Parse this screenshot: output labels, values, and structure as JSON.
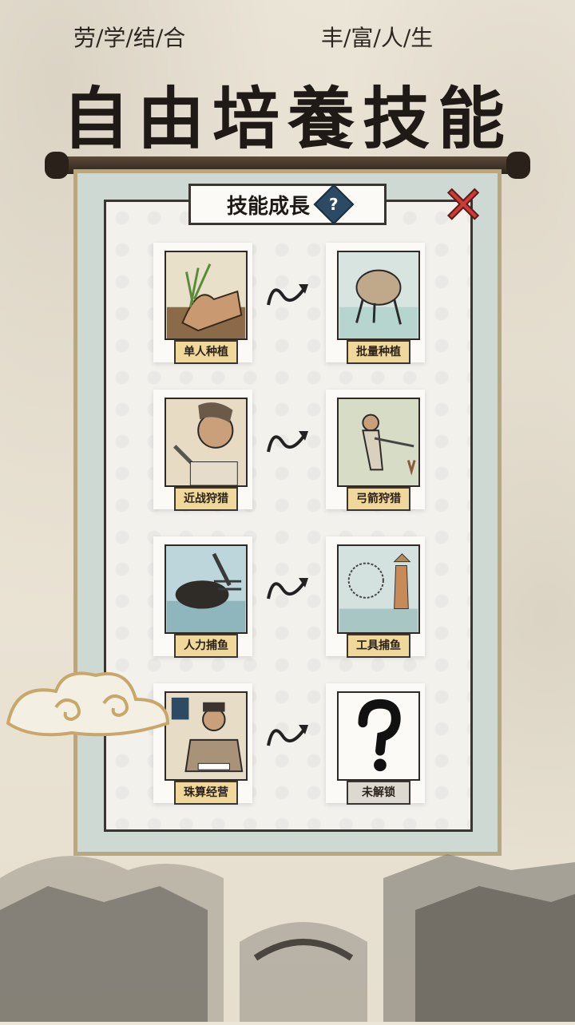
{
  "slogan": {
    "left": "劳/学/结/合",
    "right": "丰/富/人/生"
  },
  "headline": "自由培養技能",
  "panel": {
    "title": "技能成長",
    "help_icon": "question-diamond-icon",
    "close_icon": "close-x-icon"
  },
  "skills": [
    {
      "from": "单人种植",
      "to": "批量种植"
    },
    {
      "from": "近战狩猎",
      "to": "弓箭狩猎"
    },
    {
      "from": "人力捕鱼",
      "to": "工具捕鱼"
    },
    {
      "from": "珠算经营",
      "to": "未解锁"
    }
  ],
  "colors": {
    "tag": "#f0d79a",
    "locked_tag": "#ddd9d1",
    "close": "#cc3b35",
    "help": "#2c4a63"
  }
}
